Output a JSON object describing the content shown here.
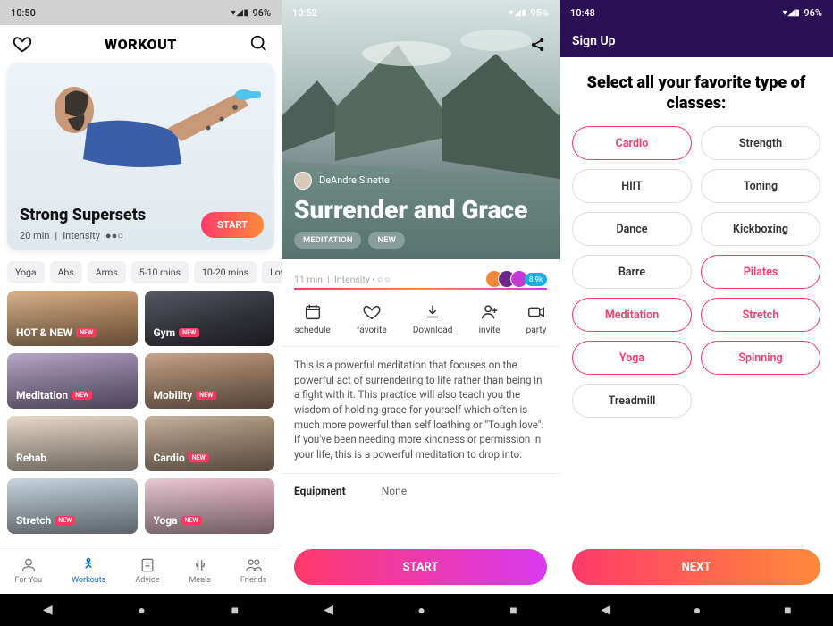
{
  "s1": {
    "status": {
      "time": "10:50",
      "battery": "96%"
    },
    "header": {
      "title": "WORKOUT"
    },
    "hero": {
      "title": "Strong Supersets",
      "duration": "20 min",
      "intensity_label": "Intensity",
      "start": "START"
    },
    "chips": [
      "Yoga",
      "Abs",
      "Arms",
      "5-10 mins",
      "10-20 mins",
      "Low intensity"
    ],
    "categories": [
      {
        "label": "HOT & NEW",
        "badge": "NEW",
        "bg": "linear-gradient(135deg,#d9b38c,#b88a5f)"
      },
      {
        "label": "Gym",
        "badge": "NEW",
        "bg": "linear-gradient(135deg,#5a5a66,#2f2f38)"
      },
      {
        "label": "Meditation",
        "badge": "NEW",
        "bg": "linear-gradient(135deg,#b9a7c9,#8a7aa0)"
      },
      {
        "label": "Mobility",
        "badge": "NEW",
        "bg": "linear-gradient(135deg,#c7a58c,#9b7a60)"
      },
      {
        "label": "Rehab",
        "badge": "",
        "bg": "linear-gradient(135deg,#e7dacb,#cbbcab)"
      },
      {
        "label": "Cardio",
        "badge": "NEW",
        "bg": "linear-gradient(135deg,#c7b29c,#9e866d)"
      },
      {
        "label": "Stretch",
        "badge": "NEW",
        "bg": "linear-gradient(135deg,#c9d6df,#a7b5bf)"
      },
      {
        "label": "Yoga",
        "badge": "NEW",
        "bg": "linear-gradient(135deg,#e8c9d4,#d6a6b6)"
      }
    ],
    "tabs": [
      {
        "label": "For You"
      },
      {
        "label": "Workouts"
      },
      {
        "label": "Advice"
      },
      {
        "label": "Meals"
      },
      {
        "label": "Friends"
      }
    ],
    "active_tab": 1
  },
  "s2": {
    "status": {
      "time": "10:52",
      "battery": "95%"
    },
    "author": "DeAndre Sinette",
    "title": "Surrender and Grace",
    "tags": [
      "MEDITATION",
      "NEW"
    ],
    "meta": {
      "duration": "11 min",
      "intensity_label": "Intensity"
    },
    "count": "8.9k",
    "actions": [
      {
        "label": "schedule"
      },
      {
        "label": "favorite"
      },
      {
        "label": "Download"
      },
      {
        "label": "invite"
      },
      {
        "label": "party"
      }
    ],
    "description": "This is a powerful meditation that focuses on the powerful act of surrendering to life rather than being in a fight with it. This practice will also teach you the wisdom of holding grace for yourself which often is much more powerful than self loathing or \"Tough love\". If you've been needing more kindness or permission in your life, this is a powerful meditation to drop into.",
    "equipment": {
      "label": "Equipment",
      "value": "None"
    },
    "start": "START"
  },
  "s3": {
    "status": {
      "time": "10:48",
      "battery": "96%"
    },
    "signup": "Sign Up",
    "title": "Select all your favorite type of classes:",
    "choices": [
      {
        "label": "Cardio",
        "selected": true
      },
      {
        "label": "Strength",
        "selected": false
      },
      {
        "label": "HIIT",
        "selected": false
      },
      {
        "label": "Toning",
        "selected": false
      },
      {
        "label": "Dance",
        "selected": false
      },
      {
        "label": "Kickboxing",
        "selected": false
      },
      {
        "label": "Barre",
        "selected": false
      },
      {
        "label": "Pilates",
        "selected": true
      },
      {
        "label": "Meditation",
        "selected": true
      },
      {
        "label": "Stretch",
        "selected": true
      },
      {
        "label": "Yoga",
        "selected": true
      },
      {
        "label": "Spinning",
        "selected": true
      },
      {
        "label": "Treadmill",
        "selected": false
      }
    ],
    "next": "NEXT"
  },
  "status_icons": "⏻ ▾◢▮"
}
